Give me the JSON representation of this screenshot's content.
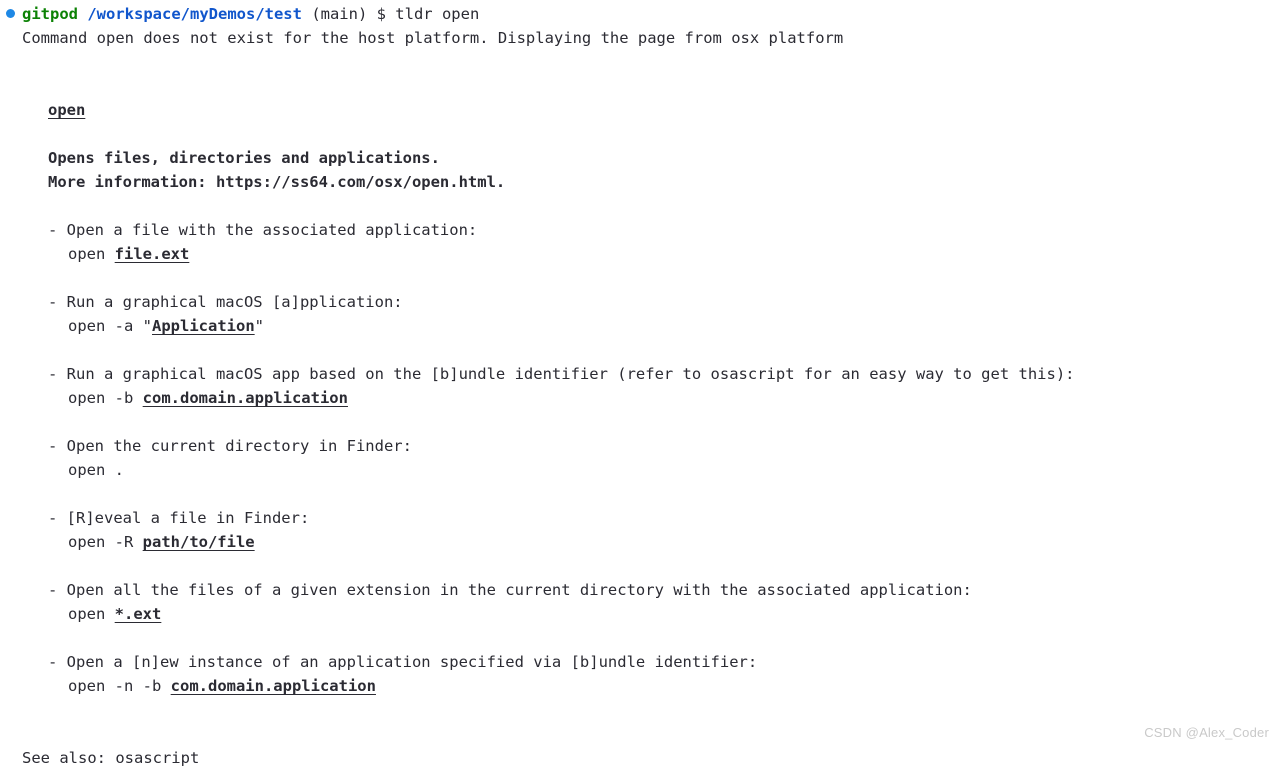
{
  "prompt": {
    "status_dot": "blue-dot-icon",
    "user": "gitpod",
    "path": "/workspace/myDemos/test",
    "branch_and_command": " (main) $ tldr open",
    "colors": {
      "dot": "#1e88e5",
      "user": "#0c8205",
      "path": "#1156cc",
      "text": "#2b2b33"
    }
  },
  "notice": "Command open does not exist for the host platform. Displaying the page from osx platform",
  "page": {
    "title": "open",
    "description_lines": [
      "Opens files, directories and applications.",
      "More information: https://ss64.com/osx/open.html."
    ],
    "examples": [
      {
        "description": "- Open a file with the associated application:",
        "command_prefix": "open ",
        "arg": "file.ext",
        "command_suffix": ""
      },
      {
        "description": "- Run a graphical macOS [a]pplication:",
        "command_prefix": "open -a \"",
        "arg": "Application",
        "command_suffix": "\""
      },
      {
        "description": "- Run a graphical macOS app based on the [b]undle identifier (refer to osascript for an easy way to get this):",
        "command_prefix": "open -b ",
        "arg": "com.domain.application",
        "command_suffix": ""
      },
      {
        "description": "- Open the current directory in Finder:",
        "command_prefix": "open .",
        "arg": "",
        "command_suffix": ""
      },
      {
        "description": "- [R]eveal a file in Finder:",
        "command_prefix": "open -R ",
        "arg": "path/to/file",
        "command_suffix": ""
      },
      {
        "description": "- Open all the files of a given extension in the current directory with the associated application:",
        "command_prefix": "open ",
        "arg": "*.ext",
        "command_suffix": ""
      },
      {
        "description": "- Open a [n]ew instance of an application specified via [b]undle identifier:",
        "command_prefix": "open -n -b ",
        "arg": "com.domain.application",
        "command_suffix": ""
      }
    ],
    "see_also": "See also: osascript"
  },
  "watermark": "CSDN @Alex_Coder"
}
